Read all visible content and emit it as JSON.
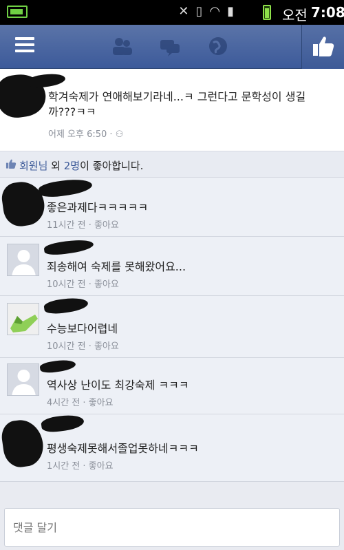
{
  "status_bar": {
    "ampm": "오전",
    "time": "7:08",
    "icons": [
      "battery-charging-icon",
      "mute-icon",
      "vibrate-icon",
      "wifi-icon",
      "signal-icon",
      "battery-icon"
    ]
  },
  "nav": {
    "icons": [
      "menu-icon",
      "friends-icon",
      "messages-icon",
      "notifications-globe-icon",
      "like-icon"
    ],
    "accent": "#3b5998"
  },
  "post": {
    "text": "학겨숙제가 연애해보기라네...ㅋ 그런다고 문학성이 생길까???ㅋㅋ",
    "time": "어제 오후 6:50 · ",
    "privacy_icon": "friends-privacy-icon"
  },
  "likes": {
    "prefix": "회원님",
    "middle": " 외 ",
    "count": "2명",
    "suffix": "이 좋아합니다."
  },
  "comments": [
    {
      "text": "좋은과제다ㅋㅋㅋㅋㅋ",
      "time": "11시간 전",
      "like": "좋아요"
    },
    {
      "text": "죄송해여 숙제를 못해왔어요...",
      "time": "10시간 전",
      "like": "좋아요"
    },
    {
      "text": "수능보다어렵네",
      "time": "10시간 전",
      "like": "좋아요"
    },
    {
      "text": "역사상 난이도 최강숙제 ㅋㅋㅋ",
      "time": "4시간 전",
      "like": "좋아요"
    },
    {
      "text": "평생숙제못해서졸업못하네ㅋㅋㅋ",
      "time": "1시간 전",
      "like": "좋아요"
    }
  ],
  "input": {
    "placeholder": "댓글 달기"
  },
  "sep": " · "
}
